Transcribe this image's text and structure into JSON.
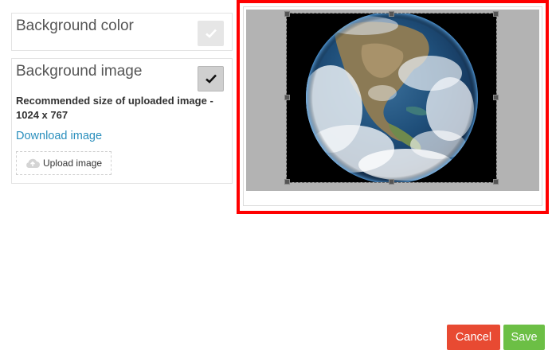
{
  "background_color": {
    "label": "Background color",
    "checked": false
  },
  "background_image": {
    "label": "Background image",
    "checked": true,
    "recommended_text": "Recommended size of uploaded image - 1024 x 767",
    "download_link": "Download image",
    "upload_label": "Upload image"
  },
  "preview": {
    "image_alt": "earth-photo"
  },
  "actions": {
    "cancel_label": "Cancel",
    "save_label": "Save"
  },
  "colors": {
    "highlight_border": "#ff0000",
    "cancel_bg": "#e84a32",
    "save_bg": "#6cbf45",
    "link": "#2a8fbd"
  }
}
